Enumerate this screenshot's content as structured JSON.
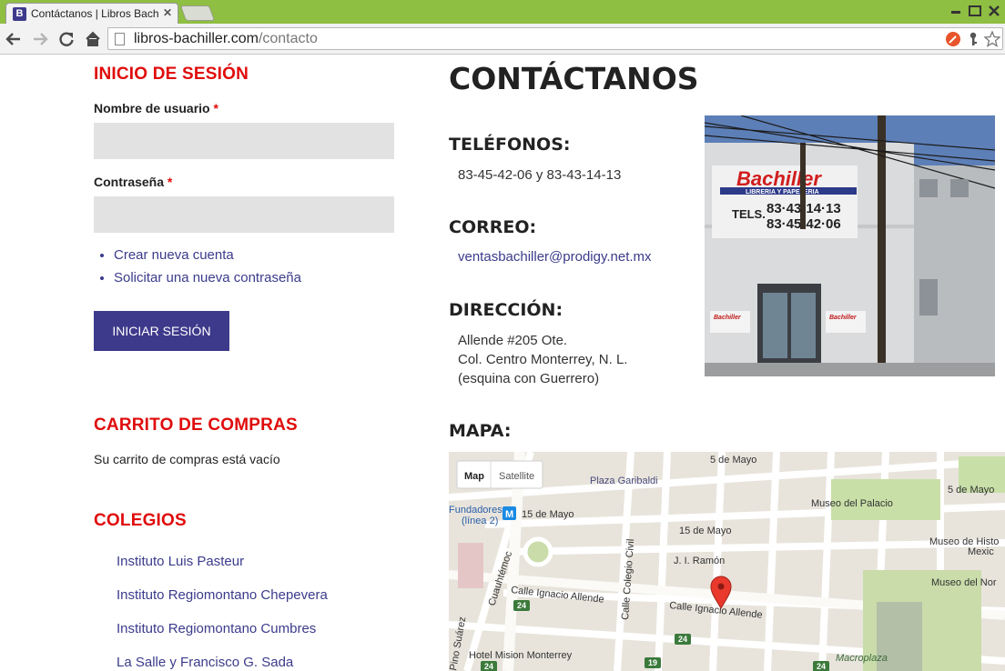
{
  "browser": {
    "tab_title": "Contáctanos | Libros Bachi",
    "tab_favicon": "B",
    "url_domain": "libros-bachiller.com",
    "url_path": "/contacto"
  },
  "login": {
    "title": "INICIO DE SESIÓN",
    "username_label": "Nombre de usuario",
    "password_label": "Contraseña",
    "required_mark": "*",
    "username_value": "",
    "password_value": "",
    "links": [
      "Crear nueva cuenta",
      "Solicitar una nueva contraseña"
    ],
    "submit_label": "INICIAR SESIÓN"
  },
  "cart": {
    "title": "CARRITO DE COMPRAS",
    "empty_text": "Su carrito de compras está vacío"
  },
  "colegios": {
    "title": "COLEGIOS",
    "items": [
      "Instituto Luis Pasteur",
      "Instituto Regiomontano Chepevera",
      "Instituto Regiomontano Cumbres",
      "La Salle y Francisco G. Sada"
    ]
  },
  "contact": {
    "title": "CONTÁCTANOS",
    "phones_title": "TELÉFONOS:",
    "phones": "83-45-42-06 y 83-43-14-13",
    "email_title": "CORREO:",
    "email": "ventasbachiller@prodigy.net.mx",
    "address_title": "DIRECCIÓN:",
    "address_lines": [
      "Allende #205 Ote.",
      "Col. Centro Monterrey, N. L.",
      "(esquina con Guerrero)"
    ],
    "map_title": "MAPA:"
  },
  "photo": {
    "sign_name": "Bachiller",
    "sign_sub": "LIBRERIA Y PAPELERIA",
    "sign_tels_label": "TELS.",
    "sign_tel1": "83·43·14·13",
    "sign_tel2": "83·45·42·06"
  },
  "map": {
    "type_map": "Map",
    "type_satellite": "Satellite",
    "labels": {
      "cinco_mayo_1": "5 de Mayo",
      "cinco_mayo_2": "5 de Mayo",
      "plaza_garibaldi": "Plaza Garibaldi",
      "fundadores": "Fundadores",
      "linea2": "(línea 2)",
      "quince_mayo_1": "15 de Mayo",
      "quince_mayo_2": "15 de Mayo",
      "museo_palacio": "Museo del Palacio",
      "museo_historia": "Museo de Histo",
      "mexico": "Mexic",
      "museo_noreste": "Museo del Nor",
      "colegio_civil": "Calle Colegio Civil",
      "jj_ramon": "J. I. Ramón",
      "allende_1": "Calle Ignacio Allende",
      "allende_2": "Calle Ignacio Allende",
      "cuauhtemoc": "Cuauhtémoc",
      "pino_suarez": "Pino Suárez",
      "hotel": "Hotel Mision Monterrey",
      "macroplaza": "Macroplaza",
      "shield_24a": "24",
      "shield_24b": "24",
      "shield_24c": "24",
      "shield_24d": "24",
      "shield_19": "19",
      "metro_m": "M"
    }
  },
  "colors": {
    "accent_red": "#e00b0b",
    "brand_purple": "#3d3a8c",
    "link": "#3b3b8c",
    "chrome_green": "#8ebe42"
  }
}
